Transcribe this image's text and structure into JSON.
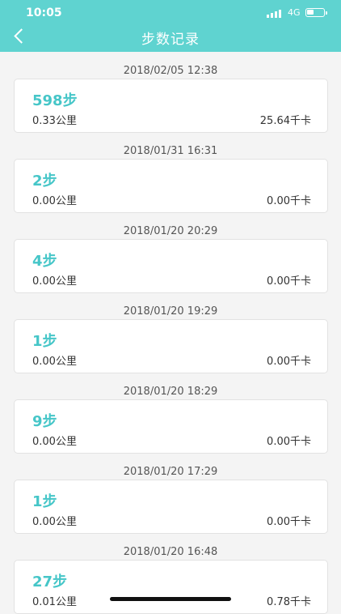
{
  "status": {
    "time": "10:05",
    "network": "4G"
  },
  "nav": {
    "title": "步数记录"
  },
  "records": [
    {
      "timestamp": "2018/02/05 12:38",
      "steps": "598步",
      "distance": "0.33公里",
      "calories": "25.64千卡"
    },
    {
      "timestamp": "2018/01/31 16:31",
      "steps": "2步",
      "distance": "0.00公里",
      "calories": "0.00千卡"
    },
    {
      "timestamp": "2018/01/20 20:29",
      "steps": "4步",
      "distance": "0.00公里",
      "calories": "0.00千卡"
    },
    {
      "timestamp": "2018/01/20 19:29",
      "steps": "1步",
      "distance": "0.00公里",
      "calories": "0.00千卡"
    },
    {
      "timestamp": "2018/01/20 18:29",
      "steps": "9步",
      "distance": "0.00公里",
      "calories": "0.00千卡"
    },
    {
      "timestamp": "2018/01/20 17:29",
      "steps": "1步",
      "distance": "0.00公里",
      "calories": "0.00千卡"
    },
    {
      "timestamp": "2018/01/20 16:48",
      "steps": "27步",
      "distance": "0.01公里",
      "calories": "0.78千卡"
    }
  ]
}
